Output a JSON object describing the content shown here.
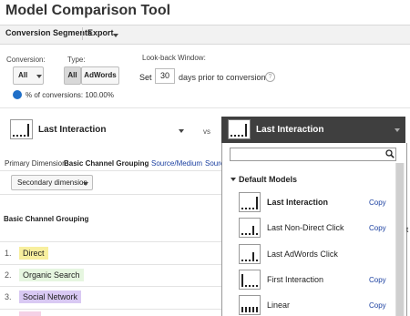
{
  "app_title": "Model Comparison Tool",
  "tabs": {
    "conversion_segments": "Conversion Segments",
    "export": "Export"
  },
  "filters": {
    "conversion_label": "Conversion:",
    "conversion_value": "All",
    "type_label": "Type:",
    "type_all": "All",
    "type_adwords": "AdWords",
    "lookback_label": "Look-back Window:",
    "set_label": "Set",
    "days_value": "30",
    "days_suffix": "days prior to conversion",
    "help": "?"
  },
  "conversions_pct": "% of conversions: 100.00%",
  "left_model": "Last Interaction",
  "vs": "vs",
  "right_model": "Last Interaction",
  "primary_dimension": {
    "label": "Primary Dimension:",
    "active": "Basic Channel Grouping",
    "links": [
      "Source/Medium",
      "Sourc"
    ]
  },
  "secondary_dimension": "Secondary dimension",
  "table": {
    "header": "Basic Channel Grouping",
    "rows": [
      {
        "num": "1.",
        "label": "Direct",
        "color": "#f8ef9e"
      },
      {
        "num": "2.",
        "label": "Organic Search",
        "color": "#e6f6e0"
      },
      {
        "num": "3.",
        "label": "Social Network",
        "color": "#d9c9f3"
      }
    ]
  },
  "dropdown": {
    "section": "Default Models",
    "items": [
      {
        "label": "Last Interaction",
        "copy": "Copy",
        "bold": true
      },
      {
        "label": "Last Non-Direct Click",
        "copy": "Copy"
      },
      {
        "label": "Last AdWords Click",
        "copy": ""
      },
      {
        "label": "First Interaction",
        "copy": "Copy"
      },
      {
        "label": "Linear",
        "copy": "Copy"
      }
    ]
  },
  "colors": {
    "accent": "#1f6fc8",
    "dropdown_header": "#3f3f3f",
    "link": "#1a3fa0"
  }
}
